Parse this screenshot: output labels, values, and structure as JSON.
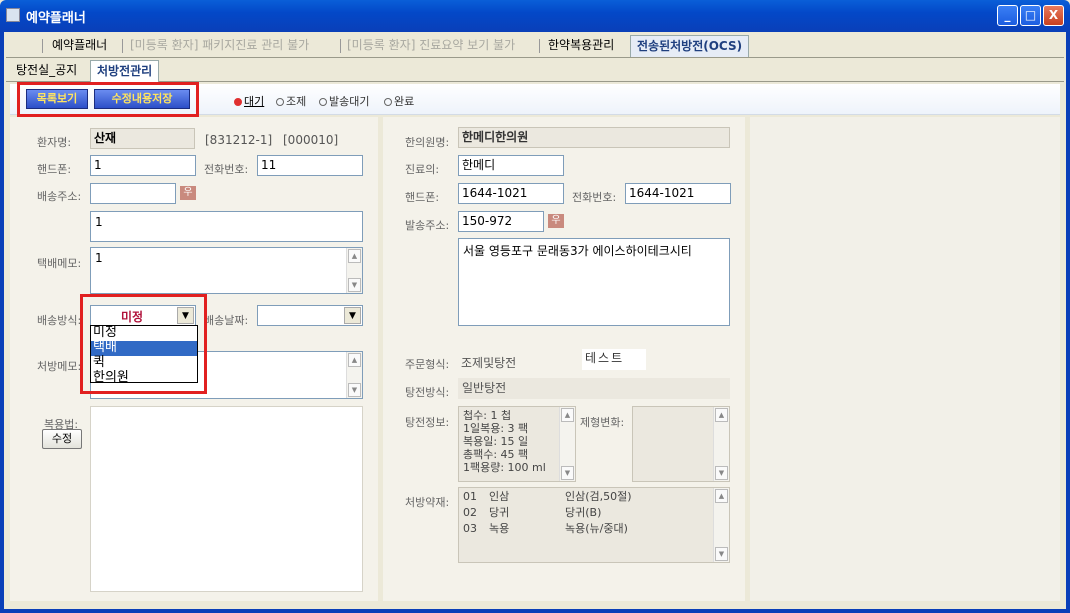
{
  "window": {
    "title": "예약플래너",
    "btn_min": "_",
    "btn_max": "□",
    "btn_close": "X"
  },
  "top_tabs": [
    {
      "label": "예약플래너"
    },
    {
      "label": "[미등록 환자] 패키지진료 관리 불가"
    },
    {
      "label": "[미등록 환자] 진료요약 보기 불가"
    },
    {
      "label": "한약복용관리"
    },
    {
      "label": "전송된처방전(OCS)"
    }
  ],
  "sub_tabs": [
    {
      "label": "탕전실_공지"
    },
    {
      "label": "처방전관리"
    }
  ],
  "toolbar": {
    "list_button": "목록보기",
    "save_button": "수정내용저장"
  },
  "status_radios": [
    {
      "label": "대기",
      "checked": true
    },
    {
      "label": "조제",
      "checked": false
    },
    {
      "label": "발송대기",
      "checked": false
    },
    {
      "label": "완료",
      "checked": false
    }
  ],
  "left": {
    "patient_label": "환자명:",
    "patient_name": "산재",
    "patient_code1": "[831212-1]",
    "patient_code2": "[000010]",
    "mobile_label": "핸드폰:",
    "mobile_value": "1",
    "phone_label": "전화번호:",
    "phone_value": "11",
    "address_label": "배송주소:",
    "address_zip": "",
    "zip_button": "우",
    "address_detail": "1",
    "delivery_memo_label": "택배메모:",
    "delivery_memo": "1",
    "delivery_method_label": "배송방식:",
    "delivery_method_value": "미정",
    "delivery_method_options": [
      "미정",
      "택배",
      "퀵",
      "한의원"
    ],
    "delivery_method_highlighted": "택배",
    "delivery_date_label": "배송날짜:",
    "delivery_date_value": "",
    "rx_memo_label": "처방메모:",
    "dosage_label": "복용법:",
    "edit_button": "수정"
  },
  "right": {
    "clinic_label": "한의원명:",
    "clinic_value": "한메디한의원",
    "doctor_label": "진료의:",
    "doctor_value": "한메디",
    "mobile_label": "핸드폰:",
    "mobile_value": "1644-1021",
    "phone_label": "전화번호:",
    "phone_value": "1644-1021",
    "send_address_label": "발송주소:",
    "send_zip": "150-972",
    "zip_button": "우",
    "send_address_detail": "서울 영등포구 문래동3가 에이스하이테크시티",
    "order_type_label": "주문형식:",
    "order_type_value": "조제및탕전",
    "order_note": "테스트",
    "decoction_method_label": "탕전방식:",
    "decoction_method_value": "일반탕전",
    "decoction_info_label": "탕전정보:",
    "decoction_info": [
      "첩수: 1 첩",
      "1일복용: 3 팩",
      "복용일: 15 일",
      "총팩수: 45 팩",
      "1팩용량: 100 ml"
    ],
    "form_change_label": "제형변화:",
    "herbs_label": "처방약재:",
    "herbs": [
      {
        "no": "01",
        "name": "인삼",
        "detail": "인삼(검,50절)"
      },
      {
        "no": "02",
        "name": "당귀",
        "detail": "당귀(B)"
      },
      {
        "no": "03",
        "name": "녹용",
        "detail": "녹용(뉴/중대)"
      }
    ]
  }
}
